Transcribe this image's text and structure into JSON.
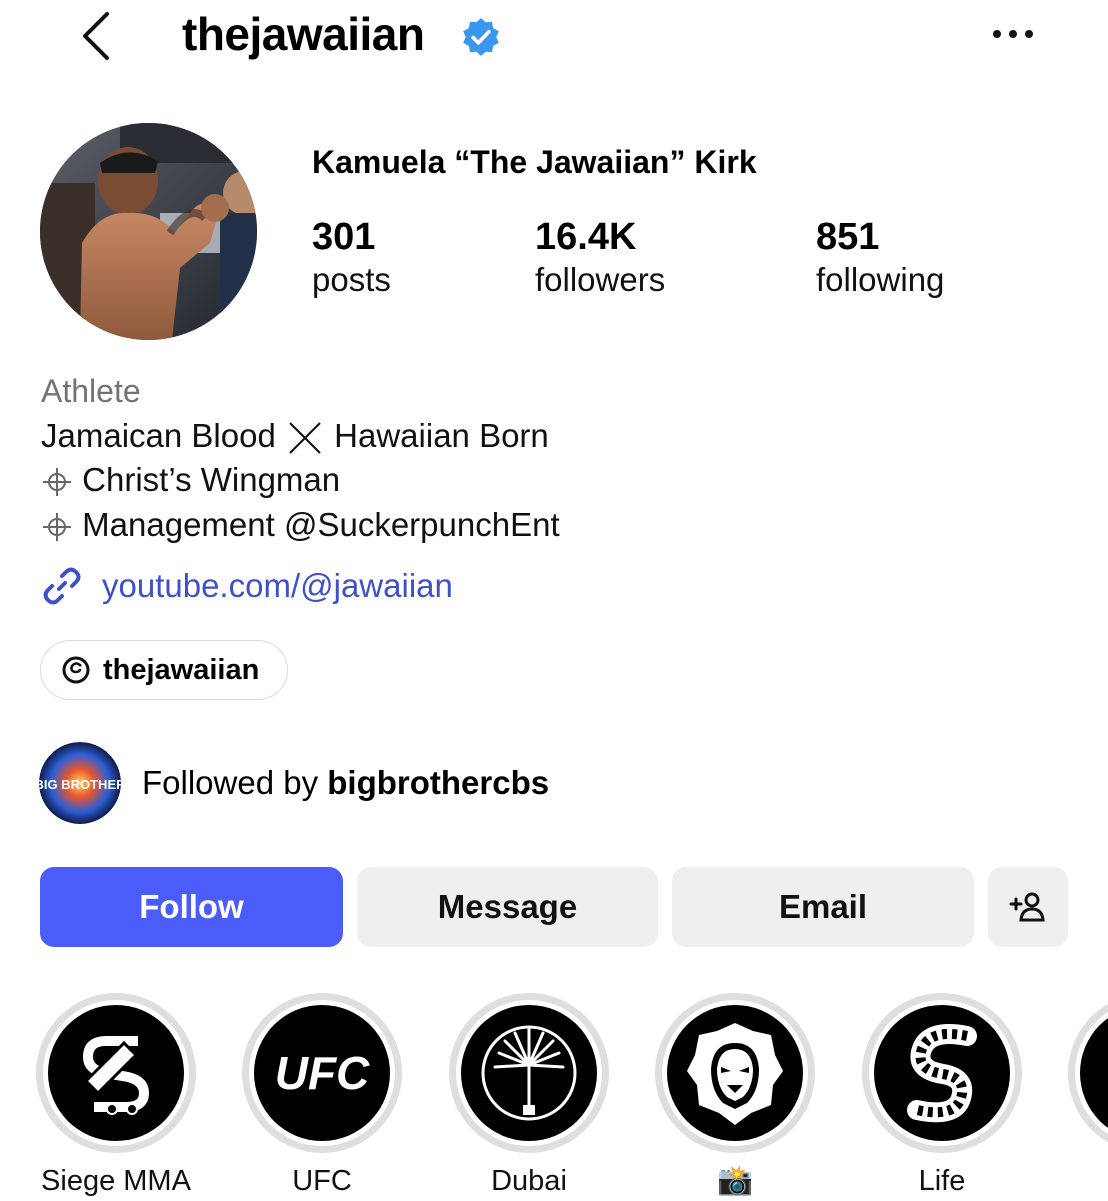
{
  "header": {
    "username": "thejawaiian",
    "back_icon": "chevron-left-icon",
    "verified_icon": "verified-badge-icon",
    "more_icon": "more-horizontal-icon",
    "verified_color": "#3897f0"
  },
  "profile": {
    "display_name": "Kamuela “The Jawaiian” Kirk",
    "stats": [
      {
        "value": "301",
        "label": "posts"
      },
      {
        "value": "16.4K",
        "label": "followers"
      },
      {
        "value": "851",
        "label": "following"
      }
    ]
  },
  "bio": {
    "category": "Athlete",
    "line1_a": "Jamaican Blood",
    "line1_b": "Hawaiian Born",
    "line2": "Christ’s Wingman",
    "line3": "Management @SuckerpunchEnt",
    "link": "youtube.com/@jawaiian",
    "link_color": "#3f51c8"
  },
  "threads": {
    "label": "thejawaiian",
    "icon": "threads-icon"
  },
  "mutual": {
    "prefix": "Followed by ",
    "account": "bigbrothercbs",
    "avatar_text": "BIG BROTHER"
  },
  "actions": {
    "follow": "Follow",
    "message": "Message",
    "email": "Email",
    "suggest_icon": "add-person-icon",
    "follow_color": "#4a5df9"
  },
  "highlights": [
    {
      "label": "Siege MMA",
      "icon": "siege-mma-logo"
    },
    {
      "label": "UFC",
      "icon": "ufc-logo",
      "logo_text": "UFC"
    },
    {
      "label": "Dubai",
      "icon": "palm-island-icon"
    },
    {
      "label": "📸",
      "icon": "lion-icon"
    },
    {
      "label": "Life",
      "icon": "film-strip-icon"
    },
    {
      "label": "",
      "icon": "highlight-partial"
    }
  ]
}
